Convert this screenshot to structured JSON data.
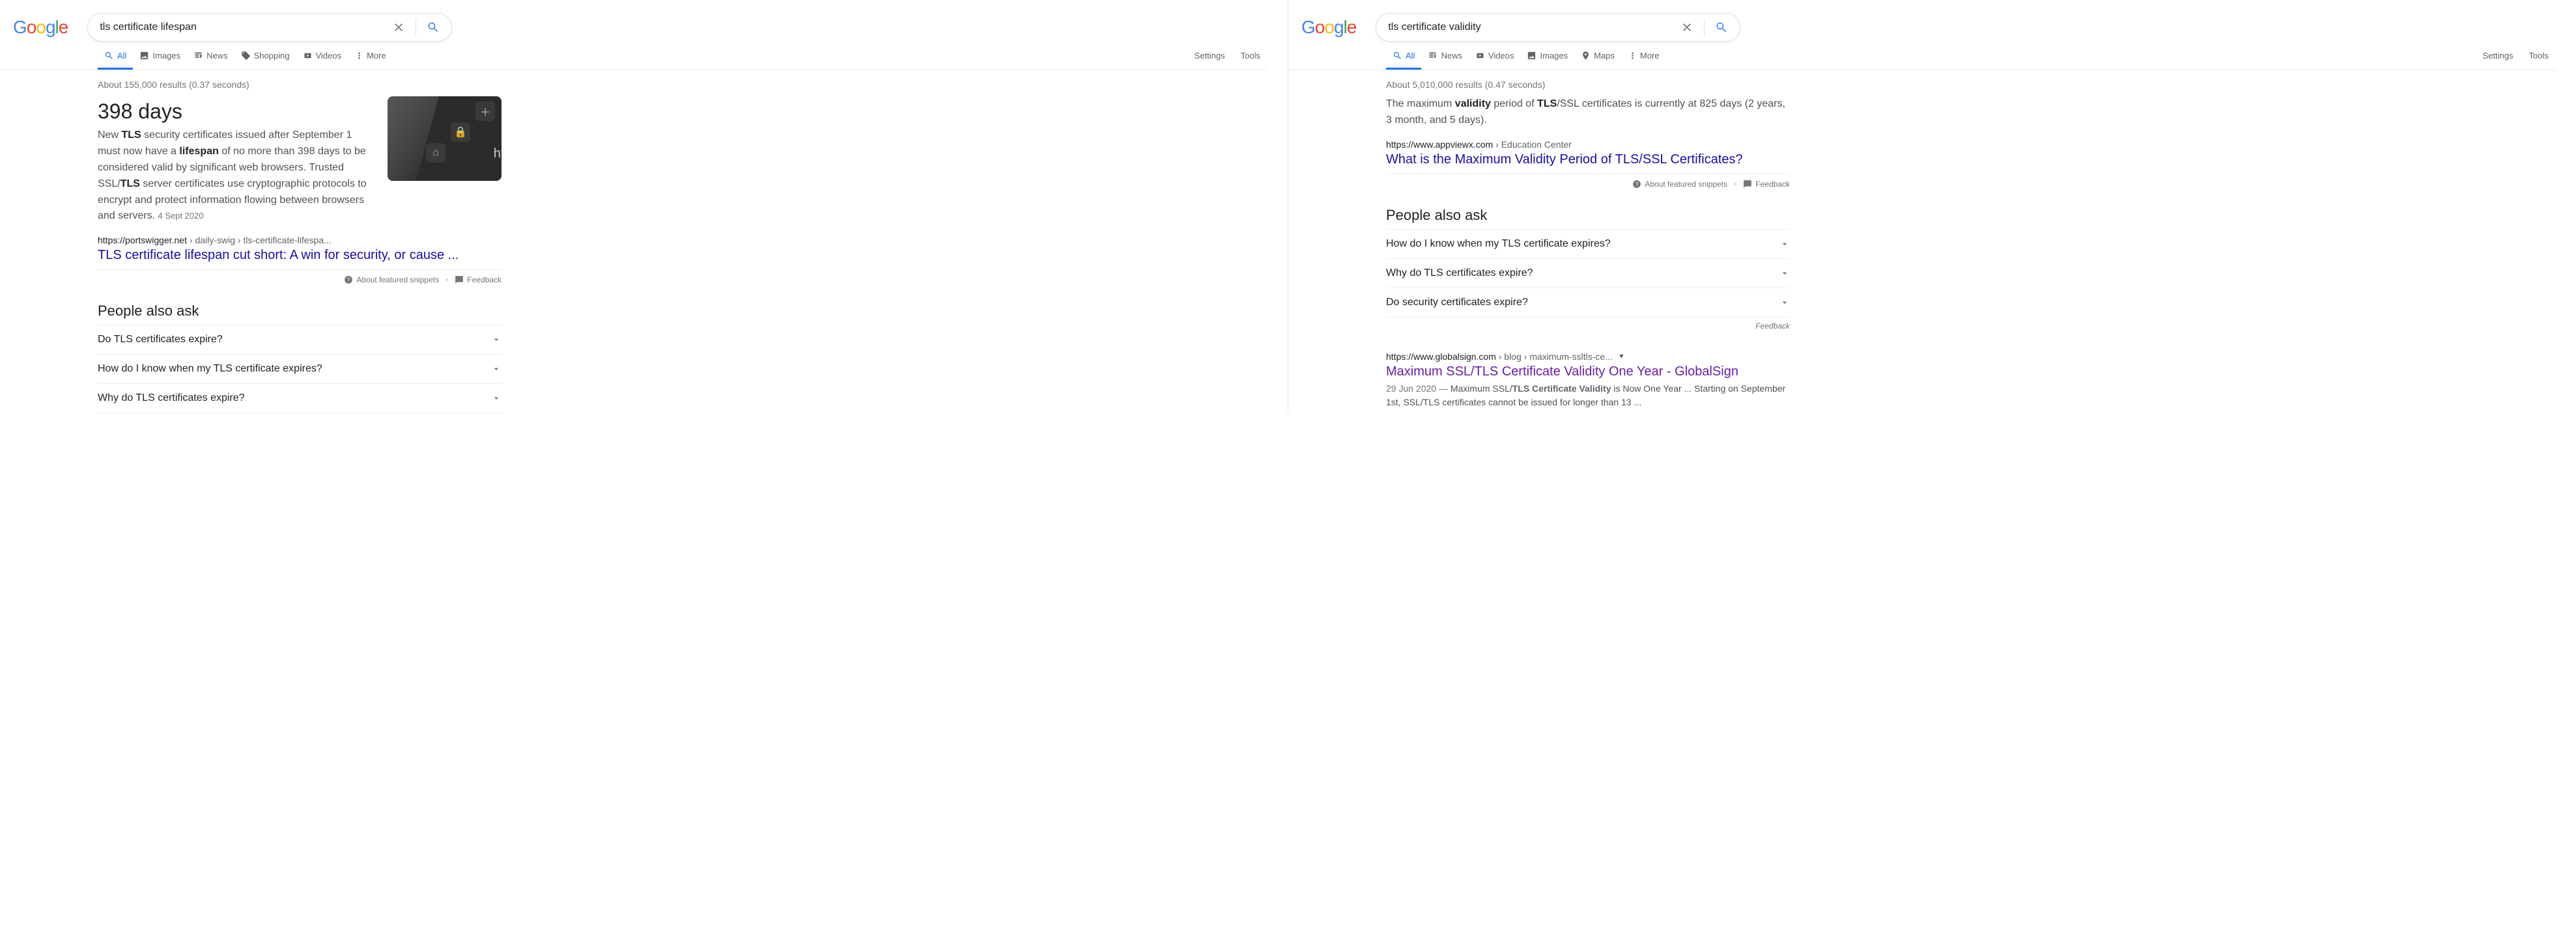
{
  "logo_letters": [
    "G",
    "o",
    "o",
    "g",
    "l",
    "e"
  ],
  "left": {
    "query": "tls certificate lifespan",
    "tabs": [
      {
        "label": "All",
        "icon": "search",
        "active": true
      },
      {
        "label": "Images",
        "icon": "image"
      },
      {
        "label": "News",
        "icon": "news"
      },
      {
        "label": "Shopping",
        "icon": "tag"
      },
      {
        "label": "Videos",
        "icon": "video"
      },
      {
        "label": "More",
        "icon": "more"
      }
    ],
    "settings": "Settings",
    "tools": "Tools",
    "stats": "About 155,000 results (0.37 seconds)",
    "featured": {
      "title": "398 days",
      "html": "New <b>TLS</b> security certificates issued after September 1 must now have a <b>lifespan</b> of no more than 398 days to be considered valid by significant web browsers. Trusted SSL/<b>TLS</b> server certificates use cryptographic protocols to encrypt and protect information flowing between browsers and servers.",
      "date": "4 Sept 2020",
      "cite_domain": "https://portswigger.net",
      "cite_path": " › daily-swig › tls-certificate-lifespa...",
      "link": "TLS certificate lifespan cut short: A win for security, or cause ..."
    },
    "about": "About featured snippets",
    "feedback": "Feedback",
    "paa_title": "People also ask",
    "paa": [
      "Do TLS certificates expire?",
      "How do I know when my TLS certificate expires?",
      "Why do TLS certificates expire?"
    ]
  },
  "right": {
    "query": "tls certificate validity",
    "tabs": [
      {
        "label": "All",
        "icon": "search",
        "active": true
      },
      {
        "label": "News",
        "icon": "news"
      },
      {
        "label": "Videos",
        "icon": "video"
      },
      {
        "label": "Images",
        "icon": "image"
      },
      {
        "label": "Maps",
        "icon": "pin"
      },
      {
        "label": "More",
        "icon": "more"
      }
    ],
    "settings": "Settings",
    "tools": "Tools",
    "stats": "About 5,010,000 results (0.47 seconds)",
    "featured": {
      "html": "The maximum <b>validity</b> period of <b>TLS</b>/SSL certificates is currently at 825 days (2 years, 3 month, and 5 days).",
      "cite_domain": "https://www.appviewx.com",
      "cite_path": " › Education Center",
      "link": "What is the Maximum Validity Period of TLS/SSL Certificates?"
    },
    "about": "About featured snippets",
    "feedback": "Feedback",
    "paa_title": "People also ask",
    "paa": [
      "How do I know when my TLS certificate expires?",
      "Why do TLS certificates expire?",
      "Do security certificates expire?"
    ],
    "paa_feedback": "Feedback",
    "result": {
      "cite_domain": "https://www.globalsign.com",
      "cite_path": " › blog › maximum-ssltls-ce...",
      "link": "Maximum SSL/TLS Certificate Validity One Year - GlobalSign",
      "desc": "<span class='d'>29 Jun 2020 — </span>Maximum SSL/<b>TLS Certificate Validity</b> is Now One Year ... Starting on September 1st, SSL/TLS certificates cannot be issued for longer than 13 ..."
    }
  }
}
